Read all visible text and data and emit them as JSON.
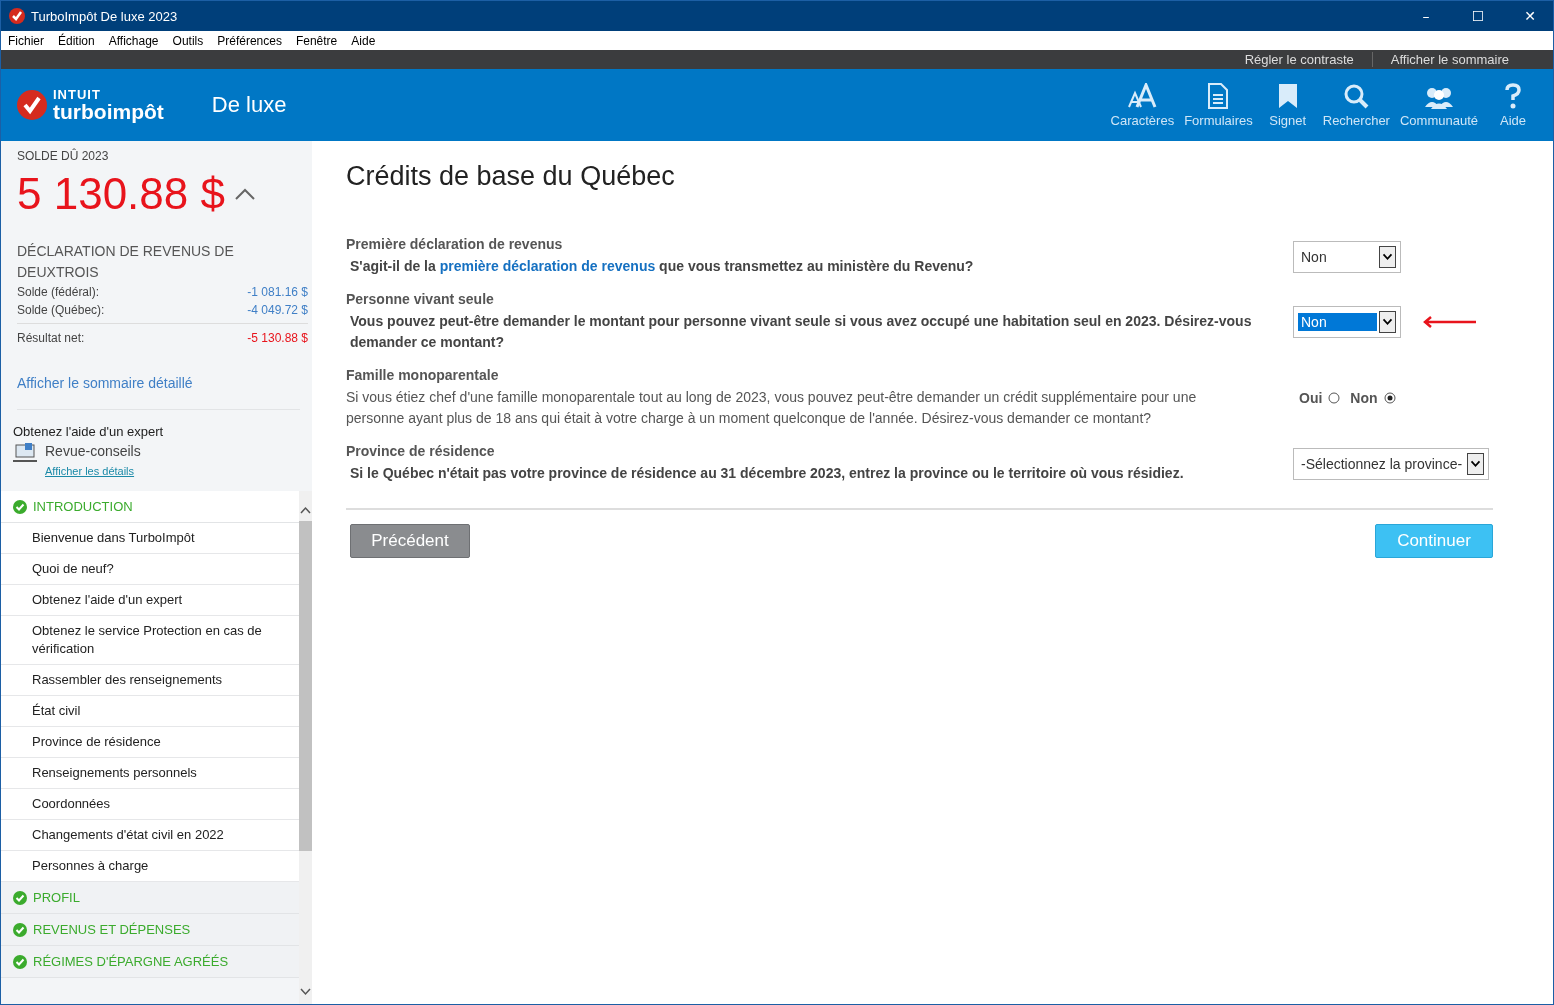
{
  "window": {
    "title": "TurboImpôt De luxe 2023",
    "controls": [
      "–",
      "☐",
      "✕"
    ]
  },
  "menu": [
    "Fichier",
    "Édition",
    "Affichage",
    "Outils",
    "Préférences",
    "Fenêtre",
    "Aide"
  ],
  "top_links": [
    "Régler le contraste",
    "Afficher le sommaire"
  ],
  "header": {
    "brand_top": "INTUIT",
    "brand": "turboimpôt",
    "edition": "De luxe",
    "tools": [
      {
        "kind": "font",
        "label": "Caractères"
      },
      {
        "kind": "forms",
        "label": "Formulaires"
      },
      {
        "kind": "bookmark",
        "label": "Signet"
      },
      {
        "kind": "search",
        "label": "Rechercher"
      },
      {
        "kind": "community",
        "label": "Communauté"
      },
      {
        "kind": "help",
        "label": "Aide"
      }
    ]
  },
  "summary": {
    "label": "SOLDE DÛ 2023",
    "amount": "5 130.88 $",
    "expanded": true,
    "return_title": "DÉCLARATION DE REVENUS DE DEUXTROIS",
    "lines": [
      {
        "label": "Solde (fédéral):",
        "value": "-1 081.16 $",
        "kind": "normal"
      },
      {
        "label": "Solde (Québec):",
        "value": "-4 049.72 $",
        "kind": "normal"
      },
      {
        "label": "Résultat net:",
        "value": "-5 130.88 $",
        "kind": "total"
      }
    ],
    "detail_link": "Afficher le sommaire détaillé"
  },
  "expert": {
    "title": "Obtenez l'aide d'un expert",
    "service": "Revue-conseils",
    "link": "Afficher les détails"
  },
  "nav": [
    {
      "label": "INTRODUCTION",
      "completed": true,
      "expanded": true,
      "children": [
        {
          "label": "Bienvenue dans TurboImpôt"
        },
        {
          "label": "Quoi de neuf?"
        },
        {
          "label": "Obtenez l'aide d'un expert"
        },
        {
          "label": "Obtenez le service Protection en cas de vérification"
        },
        {
          "label": "Rassembler des renseignements"
        },
        {
          "label": "État civil"
        },
        {
          "label": "Province de résidence"
        },
        {
          "label": "Renseignements personnels"
        },
        {
          "label": "Coordonnées"
        },
        {
          "label": "Changements d'état civil en 2022"
        },
        {
          "label": "Personnes à charge"
        }
      ]
    },
    {
      "label": "PROFIL",
      "completed": true,
      "expanded": false
    },
    {
      "label": "REVENUS ET DÉPENSES",
      "completed": true,
      "expanded": false
    },
    {
      "label": "RÉGIMES D'ÉPARGNE AGRÉÉS",
      "completed": true,
      "expanded": false
    }
  ],
  "page": {
    "title": "Crédits de base du Québec",
    "questions": [
      {
        "kind": "select",
        "heading": "Première déclaration de revenus",
        "bold": true,
        "prompt": [
          {
            "kind": "text",
            "text": "S'agit-il de la "
          },
          {
            "kind": "link",
            "text": "première déclaration de revenus"
          },
          {
            "kind": "text",
            "text": " que vous transmettez au ministère du Revenu?"
          }
        ],
        "value": "Non",
        "focused": false,
        "flagged": false
      },
      {
        "kind": "select",
        "heading": "Personne vivant seule",
        "bold": true,
        "prompt": [
          {
            "kind": "text",
            "text": "Vous pouvez peut-être demander le montant pour personne vivant seule si vous avez occupé une habitation seul en 2023. Désirez-vous demander ce montant?"
          }
        ],
        "value": "Non",
        "focused": true,
        "flagged": true
      },
      {
        "kind": "radio",
        "heading": "Famille monoparentale",
        "bold": false,
        "prompt": [
          {
            "kind": "text",
            "text": "Si vous étiez chef d'une famille monoparentale tout au long de 2023, vous pouvez peut-être demander un crédit supplémentaire pour une personne ayant plus de 18 ans qui était à votre charge à un moment quelconque de l'année. Désirez-vous demander ce montant?"
          }
        ],
        "options": [
          {
            "label": "Oui",
            "selected": false
          },
          {
            "label": "Non",
            "selected": true
          }
        ]
      },
      {
        "kind": "select",
        "heading": "Province de résidence",
        "bold": true,
        "prompt": [
          {
            "kind": "text",
            "text": "Si le Québec n'était pas votre province de résidence au 31 décembre 2023, entrez la province ou le territoire où vous résidiez."
          }
        ],
        "value": "-Sélectionnez la province-",
        "focused": false,
        "flagged": false
      }
    ],
    "back": "Précédent",
    "next": "Continuer"
  }
}
